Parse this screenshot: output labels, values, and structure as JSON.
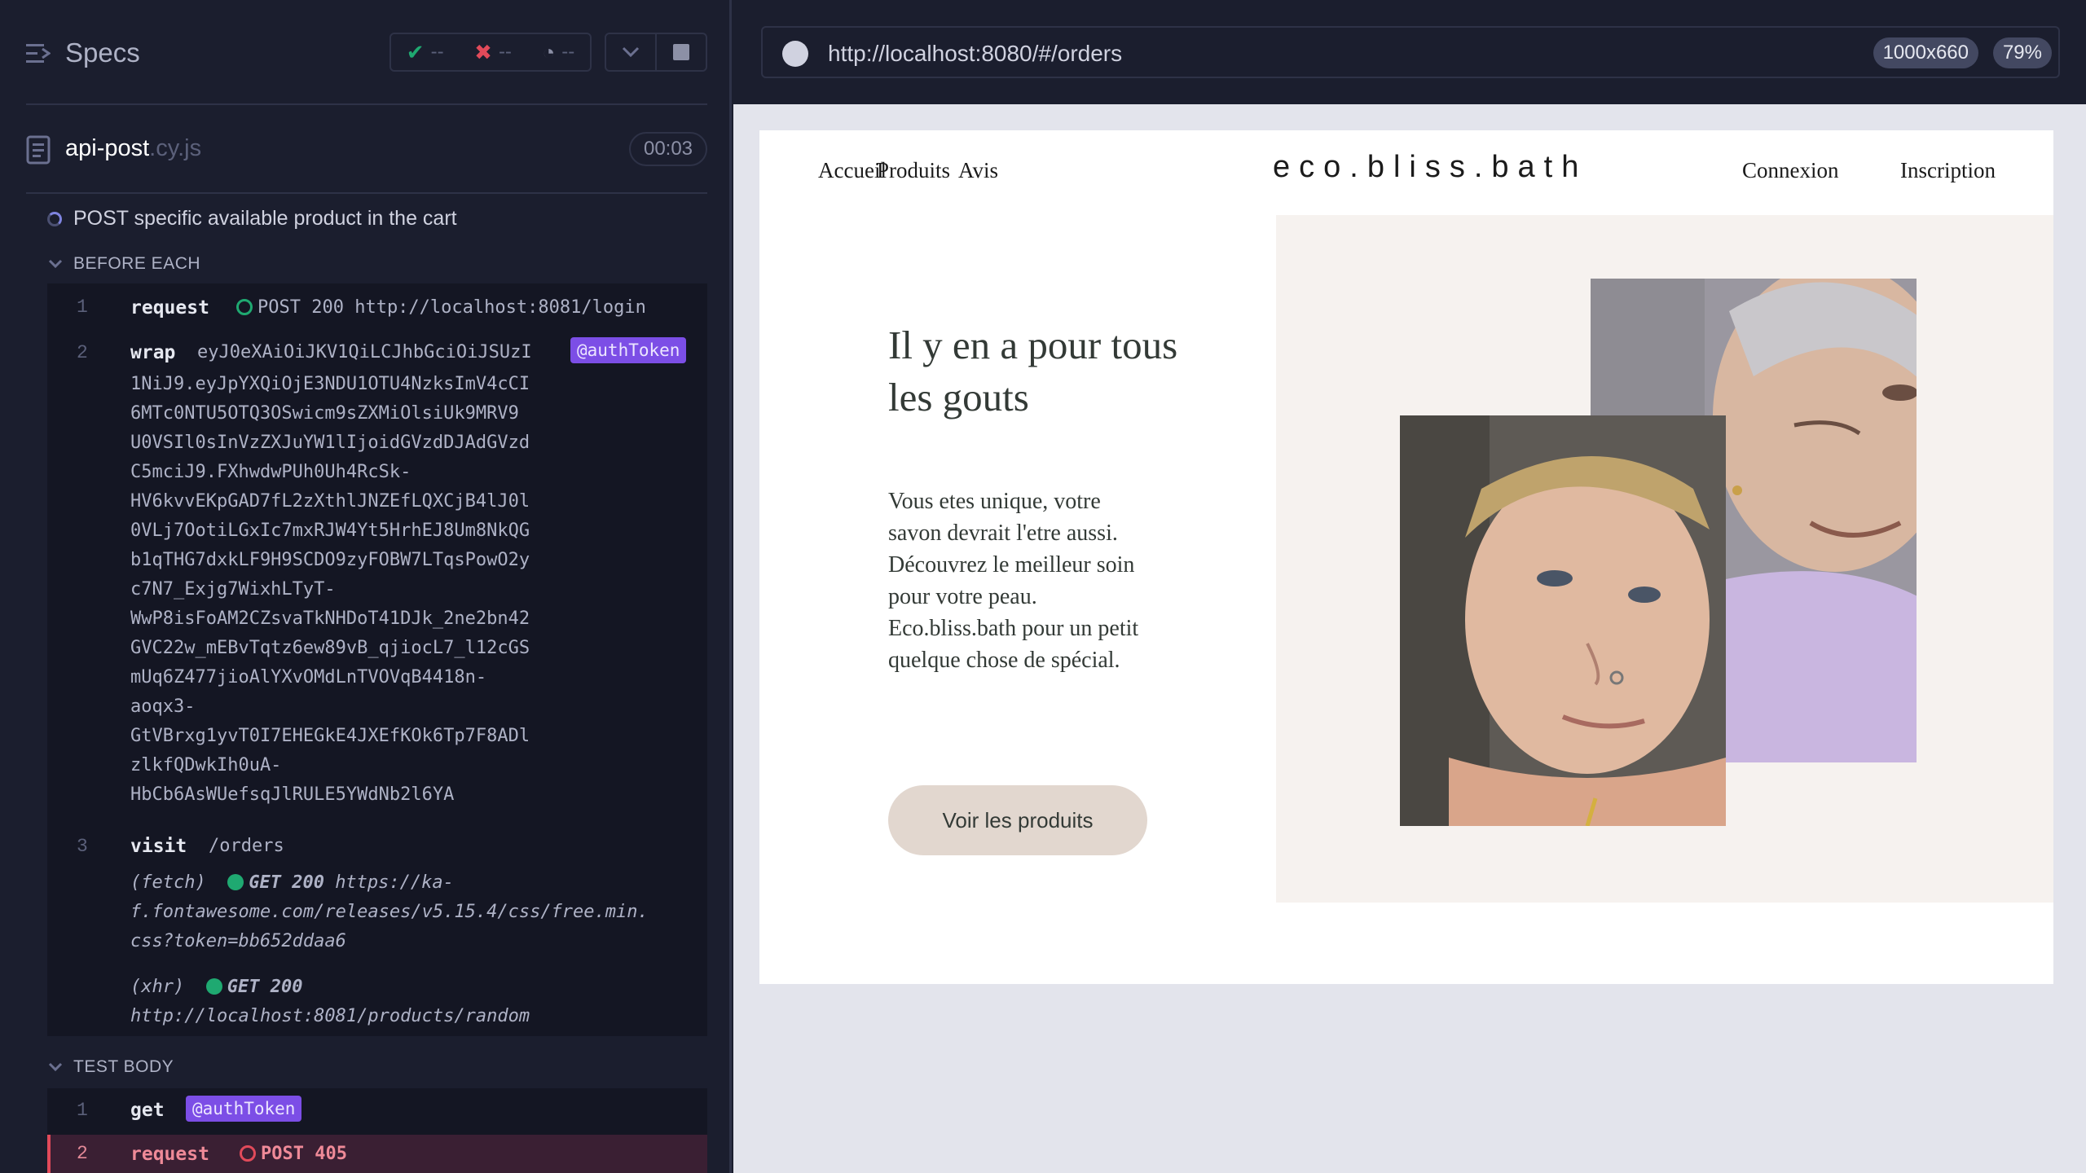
{
  "runner": {
    "header": {
      "title": "Specs",
      "passed": "--",
      "failed": "--",
      "pending": "--"
    },
    "file": {
      "name": "api-post",
      "ext": ".cy.js",
      "duration": "00:03"
    },
    "test": {
      "title": "POST specific available product in the cart"
    },
    "before_each": {
      "label": "BEFORE EACH",
      "commands": [
        {
          "num": "1",
          "name": "request",
          "detail": "POST 200 http://localhost:8081/login"
        },
        {
          "num": "2",
          "name": "wrap",
          "first_line": "eyJ0eXAiOiJKV1QiLCJhbGciOiJSUzI",
          "alias": "@authToken",
          "token_lines": [
            "1NiJ9.eyJpYXQiOjE3NDU1OTU4NzksImV4cCI",
            "6MTc0NTU5OTQ3OSwicm9sZXMiOlsiUk9MRV9",
            "U0VSIl0sInVzZXJuYW1lIjoidGVzdDJAdGVzd",
            "C5mciJ9.FXhwdwPUh0Uh4RcSk-",
            "HV6kvvEKpGAD7fL2zXthlJNZEfLQXCjB4lJ0l",
            "0VLj7OotiLGxIc7mxRJW4Yt5HrhEJ8Um8NkQG",
            "b1qTHG7dxkLF9H9SCDO9zyFOBW7LTqsPowO2y",
            "c7N7_Exjg7WixhLTyT-",
            "WwP8isFoAM2CZsvaTkNHDoT41DJk_2ne2bn42",
            "GVC22w_mEBvTqtz6ew89vB_qjiocL7_l12cGS",
            "mUq6Z477jioAlYXvOMdLnTVOVqB4418n-",
            "aoqx3-",
            "GtVBrxg1yvT0I7EHEGkE4JXEfKOk6Tp7F8ADl",
            "zlkfQDwkIh0uA-",
            "HbCb6AsWUefsqJlRULE5YWdNb2l6YA"
          ]
        },
        {
          "num": "3",
          "name": "visit",
          "detail": "/orders"
        }
      ],
      "events": [
        {
          "type": "(fetch)",
          "status": "GET 200",
          "url_lines": [
            "https://ka-",
            "f.fontawesome.com/releases/v5.15.4/css/free.min.",
            "css?token=bb652ddaa6"
          ]
        },
        {
          "type": "(xhr)",
          "status": "GET 200",
          "url_lines": [
            "http://localhost:8081/products/random"
          ]
        }
      ]
    },
    "test_body": {
      "label": "TEST BODY",
      "commands": [
        {
          "num": "1",
          "name": "get",
          "alias": "@authToken"
        },
        {
          "num": "2",
          "name": "request",
          "detail": "POST 405"
        }
      ]
    }
  },
  "browser": {
    "url": "http://localhost:8080/#/orders",
    "viewport": "1000x660",
    "zoom": "79%"
  },
  "site": {
    "nav_left": [
      "Accueil",
      "Produits",
      "Avis"
    ],
    "logo": "eco.bliss.bath",
    "nav_right": [
      "Connexion",
      "Inscription"
    ],
    "hero": {
      "title": "Il y en a pour tous les gouts",
      "text": "Vous etes unique, votre savon devrait l'etre aussi. Découvrez le meilleur soin pour votre peau. Eco.bliss.bath pour un petit quelque chose de spécial.",
      "button": "Voir les produits"
    }
  },
  "colors": {
    "runner_bg": "#1b1e2e",
    "alias_purple": "#7c4ee6",
    "pass_green": "#1fa971",
    "fail_red": "#e14a5a",
    "hero_bg": "#f6f2ef",
    "hero_button": "#e2d7cf"
  }
}
